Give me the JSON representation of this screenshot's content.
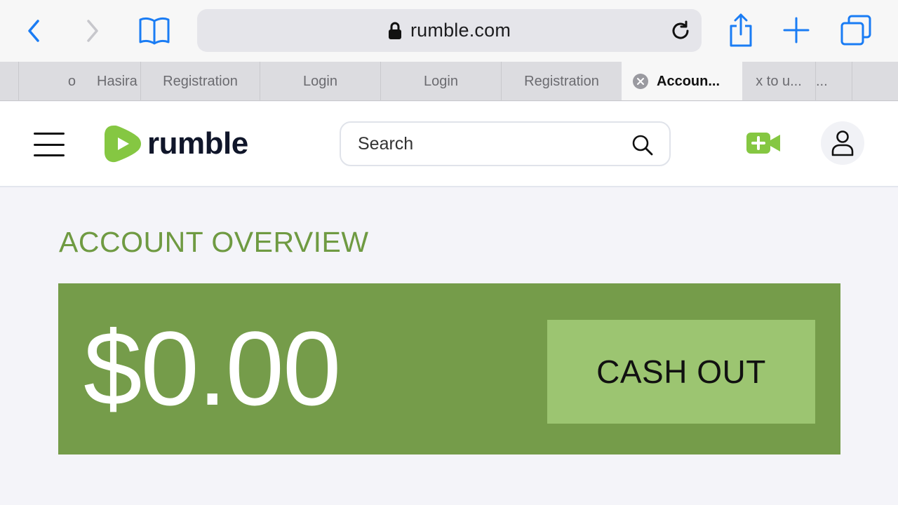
{
  "browser": {
    "url": "rumble.com",
    "icons": {
      "back": "chevron-left-icon",
      "forward": "chevron-right-icon",
      "bookmarks": "book-icon",
      "lock": "lock-icon",
      "reload": "reload-icon",
      "share": "share-icon",
      "new_tab": "plus-icon",
      "tabs": "tabs-icon"
    },
    "accent": "#1a7cf4"
  },
  "tabs": [
    {
      "label": "o"
    },
    {
      "label": "Hasira"
    },
    {
      "label": "Registration"
    },
    {
      "label": "Login"
    },
    {
      "label": "Login"
    },
    {
      "label": "Registration"
    },
    {
      "label": "Accoun...",
      "active": true
    },
    {
      "label": "x to u..."
    },
    {
      "label": "..."
    }
  ],
  "site": {
    "logo_text": "rumble",
    "search_placeholder": "Search",
    "brand_green": "#85c742"
  },
  "main": {
    "title": "ACCOUNT OVERVIEW",
    "balance": "$0.00",
    "cashout_label": "CASH OUT",
    "card_color": "#759c4a",
    "button_color": "#9cc571"
  }
}
